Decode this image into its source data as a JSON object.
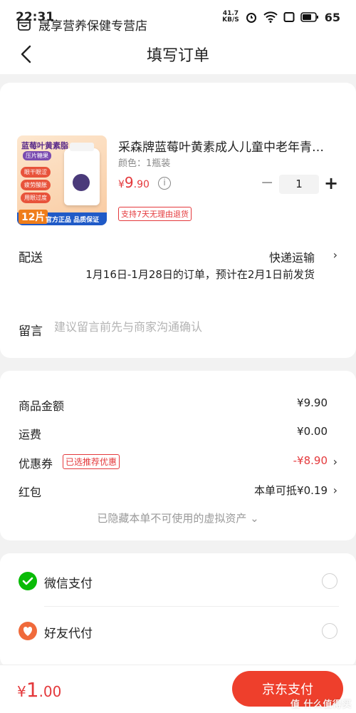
{
  "status": {
    "time": "22:31",
    "net_speed": "41.7",
    "net_unit": "KB/S",
    "battery": "65"
  },
  "nav": {
    "title": "填写订单"
  },
  "store": {
    "name": "晟享营养保健专营店"
  },
  "product": {
    "image_text": {
      "header": "蓝莓叶黄素脂",
      "sub": "压片糖果",
      "tags": [
        "眼干眼涩",
        "疲劳酸胀",
        "用眼过度"
      ],
      "count": "12片",
      "official": "官方正品 品质保证"
    },
    "title": "采森牌蓝莓叶黄素成人儿童中老年青…",
    "spec": "颜色：1瓶装",
    "price": {
      "currency": "¥",
      "integer": "9",
      "decimal": ".90"
    },
    "quantity": "1",
    "minus": "−",
    "plus": "+",
    "return_policy": "支持7天无理由退货"
  },
  "delivery": {
    "label": "配送",
    "method": "快递运输",
    "desc": "1月16日-1月28日的订单，预计在2月1日前发货"
  },
  "note": {
    "label": "留言",
    "placeholder": "建议留言前先与商家沟通确认"
  },
  "pricing": {
    "goods": {
      "label": "商品金额",
      "value": "¥9.90"
    },
    "shipping": {
      "label": "运费",
      "value": "¥0.00"
    },
    "coupon": {
      "label": "优惠券",
      "badge": "已选推荐优惠",
      "value": "-¥8.90"
    },
    "red_packet": {
      "label": "红包",
      "value": "本单可抵¥0.19"
    },
    "hidden_assets": "已隐藏本单不可使用的虚拟资产 ⌄"
  },
  "payment": {
    "wechat": {
      "label": "微信支付",
      "icon": "wechat-pay-icon"
    },
    "friend": {
      "label": "好友代付",
      "icon": "friend-pay-icon"
    }
  },
  "footer": {
    "total": {
      "currency": "¥",
      "integer": "1",
      "decimal": ".00"
    },
    "submit": "京东支付",
    "watermark": "值 什么值得买"
  },
  "colors": {
    "accent": "#e4393c",
    "button": "#ee3f2c",
    "wechat": "#09bb07",
    "friend": "#f06a3b"
  }
}
